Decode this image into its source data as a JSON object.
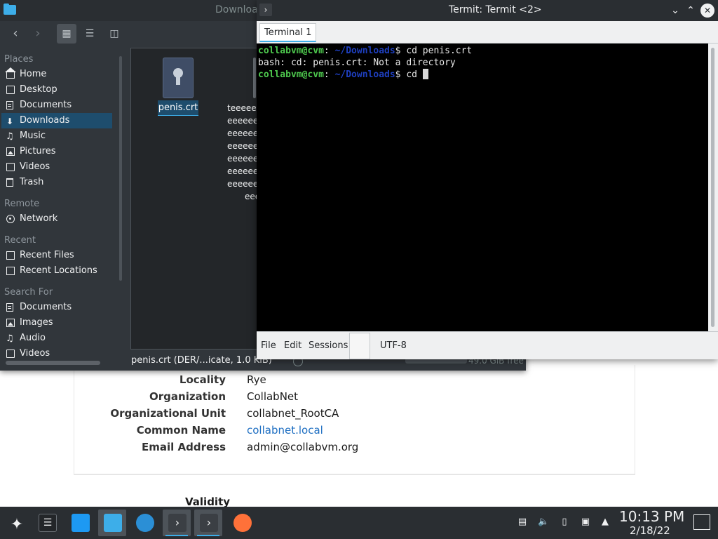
{
  "certificate": {
    "fields": [
      {
        "label": "Locality",
        "value": "Rye"
      },
      {
        "label": "Organization",
        "value": "CollabNet"
      },
      {
        "label": "Organizational Unit",
        "value": "collabnet_RootCA"
      },
      {
        "label": "Common Name",
        "value": "collabnet.local"
      },
      {
        "label": "Email Address",
        "value": "admin@collabvm.org"
      }
    ],
    "validity_heading": "Validity"
  },
  "dolphin": {
    "title": "Downloac",
    "places_header": "Places",
    "places": [
      "Home",
      "Desktop",
      "Documents",
      "Downloads",
      "Music",
      "Pictures",
      "Videos",
      "Trash"
    ],
    "remote_header": "Remote",
    "remote": [
      "Network"
    ],
    "recent_header": "Recent",
    "recent": [
      "Recent Files",
      "Recent Locations"
    ],
    "search_header": "Search For",
    "search": [
      "Documents",
      "Images",
      "Audio",
      "Videos"
    ],
    "file_name": "penis.crt",
    "preview_lines": [
      "teeeee",
      "eeeeee",
      "eeeeee",
      "eeeeee",
      "eeeeee",
      "eeeeee",
      "eeeeee",
      "eee"
    ],
    "status": "penis.crt (DER/...icate, 1.0 KiB)",
    "free_space": "49.0 GiB free"
  },
  "termit": {
    "title": "Termit: Termit <2>",
    "tab_label": "Terminal 1",
    "lines": [
      {
        "user": "collabvm@cvm",
        "sep": ":",
        "path": " ~/Downloads",
        "prompt": "$ ",
        "cmd": "cd penis.crt"
      },
      {
        "text": "bash: cd: penis.crt: Not a directory"
      },
      {
        "user": "collabvm@cvm",
        "sep": ":",
        "path": " ~/Downloads",
        "prompt": "$ ",
        "cmd": "cd "
      }
    ],
    "menu": [
      "File",
      "Edit",
      "Sessions"
    ],
    "encoding": "UTF-8"
  },
  "taskbar": {
    "time": "10:13 PM",
    "date": "2/18/22"
  }
}
